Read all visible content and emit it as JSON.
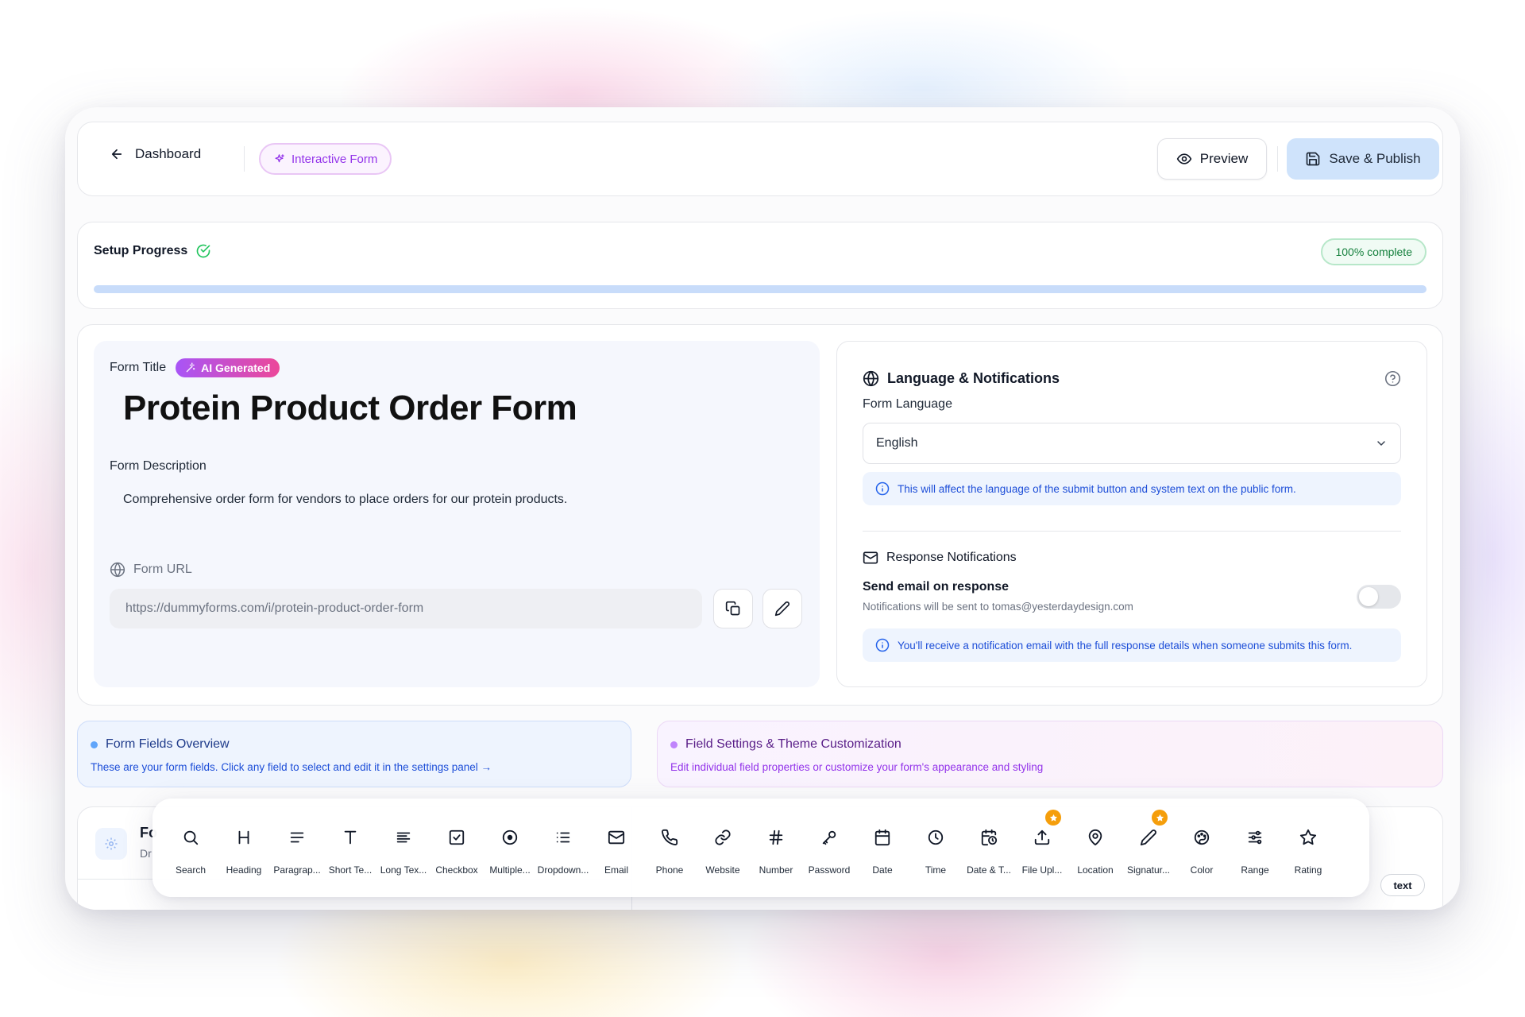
{
  "header": {
    "back_label": "Dashboard",
    "mode_label": "Interactive Form",
    "preview_label": "Preview",
    "publish_label": "Save & Publish"
  },
  "progress": {
    "title": "Setup Progress",
    "badge": "100% complete",
    "percent": 100
  },
  "form": {
    "title_label": "Form Title",
    "ai_badge": "AI Generated",
    "title": "Protein Product Order Form",
    "description_label": "Form Description",
    "description": "Comprehensive order form for vendors to place orders for our protein products.",
    "url_label": "Form URL",
    "url_value": "https://dummyforms.com/i/protein-product-order-form"
  },
  "language": {
    "title": "Language & Notifications",
    "form_language_label": "Form Language",
    "selected_language": "English",
    "language_info": "This will affect the language of the submit button and system text on the public form.",
    "notifications_title": "Response Notifications",
    "send_email_label": "Send email on response",
    "send_email_sub": "Notifications will be sent to tomas@yesterdaydesign.com",
    "notifications_info": "You'll receive a notification email with the full response details when someone submits this form.",
    "send_email_enabled": false
  },
  "overview": {
    "fields_title": "Form Fields Overview",
    "fields_sub": "These are your form fields. Click any field to select and edit it in the settings panel →",
    "settings_title": "Field Settings & Theme Customization",
    "settings_sub": "Edit individual field properties or customize your form's appearance and styling"
  },
  "bottom": {
    "partial_title": "Fo",
    "partial_sub": "Dr",
    "chip_label": "text"
  },
  "toolbar": {
    "items": [
      {
        "label": "Search",
        "icon": "search-icon"
      },
      {
        "label": "Heading",
        "icon": "heading-icon"
      },
      {
        "label": "Paragrap...",
        "icon": "paragraph-icon"
      },
      {
        "label": "Short Te...",
        "icon": "short-text-icon"
      },
      {
        "label": "Long Tex...",
        "icon": "long-text-icon"
      },
      {
        "label": "Checkbox",
        "icon": "checkbox-icon"
      },
      {
        "label": "Multiple...",
        "icon": "radio-icon"
      },
      {
        "label": "Dropdown...",
        "icon": "list-icon"
      },
      {
        "label": "Email",
        "icon": "mail-icon"
      },
      {
        "label": "Phone",
        "icon": "phone-icon"
      },
      {
        "label": "Website",
        "icon": "link-icon"
      },
      {
        "label": "Number",
        "icon": "hash-icon"
      },
      {
        "label": "Password",
        "icon": "key-icon"
      },
      {
        "label": "Date",
        "icon": "calendar-icon"
      },
      {
        "label": "Time",
        "icon": "clock-icon"
      },
      {
        "label": "Date & T...",
        "icon": "calendar-clock-icon"
      },
      {
        "label": "File Upl...",
        "icon": "upload-icon"
      },
      {
        "label": "Location",
        "icon": "map-pin-icon"
      },
      {
        "label": "Signatur...",
        "icon": "pen-icon"
      },
      {
        "label": "Color",
        "icon": "palette-icon"
      },
      {
        "label": "Range",
        "icon": "sliders-icon"
      },
      {
        "label": "Rating",
        "icon": "star-icon"
      }
    ]
  },
  "colors": {
    "accent_purple": "#9333ea",
    "publish_bg": "#cfe3fb",
    "success": "#15803d",
    "info_blue": "#1d4ed8",
    "premium": "#f59e0b"
  }
}
